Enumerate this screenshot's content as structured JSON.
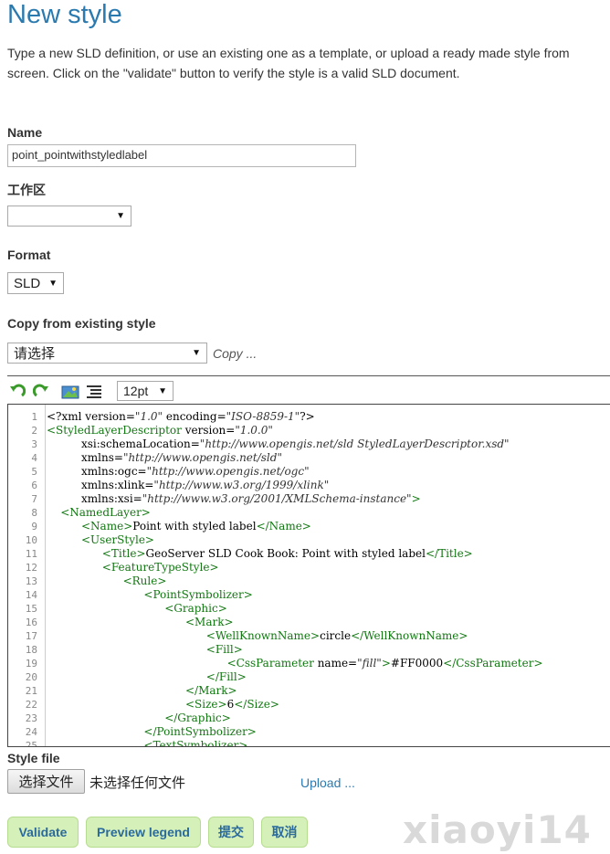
{
  "page": {
    "title": "New style",
    "intro": "Type a new SLD definition, or use an existing one as a template, or upload a ready made style from screen. Click on the \"validate\" button to verify the style is a valid SLD document."
  },
  "form": {
    "name_label": "Name",
    "name_value": "point_pointwithstyledlabel",
    "workspace_label": "工作区",
    "workspace_value": "",
    "format_label": "Format",
    "format_value": "SLD",
    "copy_label": "Copy from existing style",
    "copy_select_value": "请选择",
    "copy_link": "Copy ...",
    "style_file_label": "Style file",
    "file_button": "选择文件",
    "file_status": "未选择任何文件",
    "upload_link": "Upload ..."
  },
  "editor": {
    "font_size": "12pt",
    "icons": [
      "undo-icon",
      "redo-icon",
      "image-icon",
      "format-icon"
    ],
    "lines": [
      {
        "n": "1",
        "indent": 0,
        "parts": [
          [
            "p",
            "<?xml version="
          ],
          [
            "s",
            "\"1.0\""
          ],
          [
            "p",
            " encoding="
          ],
          [
            "s",
            "\"ISO-8859-1\""
          ],
          [
            "p",
            "?>"
          ]
        ]
      },
      {
        "n": "2",
        "indent": 0,
        "parts": [
          [
            "t",
            "<StyledLayerDescriptor"
          ],
          [
            "p",
            " version="
          ],
          [
            "s",
            "\"1.0.0\""
          ]
        ]
      },
      {
        "n": "3",
        "indent": 5,
        "parts": [
          [
            "p",
            "xsi:schemaLocation="
          ],
          [
            "s",
            "\"http://www.opengis.net/sld StyledLayerDescriptor.xsd\""
          ]
        ]
      },
      {
        "n": "4",
        "indent": 5,
        "parts": [
          [
            "p",
            "xmlns="
          ],
          [
            "s",
            "\"http://www.opengis.net/sld\""
          ]
        ]
      },
      {
        "n": "5",
        "indent": 5,
        "parts": [
          [
            "p",
            "xmlns:ogc="
          ],
          [
            "s",
            "\"http://www.opengis.net/ogc\""
          ]
        ]
      },
      {
        "n": "6",
        "indent": 5,
        "parts": [
          [
            "p",
            "xmlns:xlink="
          ],
          [
            "s",
            "\"http://www.w3.org/1999/xlink\""
          ]
        ]
      },
      {
        "n": "7",
        "indent": 5,
        "parts": [
          [
            "p",
            "xmlns:xsi="
          ],
          [
            "s",
            "\"http://www.w3.org/2001/XMLSchema-instance\""
          ],
          [
            "t",
            ">"
          ]
        ]
      },
      {
        "n": "8",
        "indent": 2,
        "parts": [
          [
            "t",
            "<NamedLayer>"
          ]
        ]
      },
      {
        "n": "9",
        "indent": 5,
        "parts": [
          [
            "t",
            "<Name>"
          ],
          [
            "p",
            "Point with styled label"
          ],
          [
            "t",
            "</Name>"
          ]
        ]
      },
      {
        "n": "10",
        "indent": 5,
        "parts": [
          [
            "t",
            "<UserStyle>"
          ]
        ]
      },
      {
        "n": "11",
        "indent": 8,
        "parts": [
          [
            "t",
            "<Title>"
          ],
          [
            "p",
            "GeoServer SLD Cook Book: Point with styled label"
          ],
          [
            "t",
            "</Title>"
          ]
        ]
      },
      {
        "n": "12",
        "indent": 8,
        "parts": [
          [
            "t",
            "<FeatureTypeStyle>"
          ]
        ]
      },
      {
        "n": "13",
        "indent": 11,
        "parts": [
          [
            "t",
            "<Rule>"
          ]
        ]
      },
      {
        "n": "14",
        "indent": 14,
        "parts": [
          [
            "t",
            "<PointSymbolizer>"
          ]
        ]
      },
      {
        "n": "15",
        "indent": 17,
        "parts": [
          [
            "t",
            "<Graphic>"
          ]
        ]
      },
      {
        "n": "16",
        "indent": 20,
        "parts": [
          [
            "t",
            "<Mark>"
          ]
        ]
      },
      {
        "n": "17",
        "indent": 23,
        "parts": [
          [
            "t",
            "<WellKnownName>"
          ],
          [
            "p",
            "circle"
          ],
          [
            "t",
            "</WellKnownName>"
          ]
        ]
      },
      {
        "n": "18",
        "indent": 23,
        "parts": [
          [
            "t",
            "<Fill>"
          ]
        ]
      },
      {
        "n": "19",
        "indent": 26,
        "parts": [
          [
            "t",
            "<CssParameter"
          ],
          [
            "p",
            " name="
          ],
          [
            "s",
            "\"fill\""
          ],
          [
            "t",
            ">"
          ],
          [
            "p",
            "#FF0000"
          ],
          [
            "t",
            "</CssParameter>"
          ]
        ]
      },
      {
        "n": "20",
        "indent": 23,
        "parts": [
          [
            "t",
            "</Fill>"
          ]
        ]
      },
      {
        "n": "21",
        "indent": 20,
        "parts": [
          [
            "t",
            "</Mark>"
          ]
        ]
      },
      {
        "n": "22",
        "indent": 20,
        "parts": [
          [
            "t",
            "<Size>"
          ],
          [
            "p",
            "6"
          ],
          [
            "t",
            "</Size>"
          ]
        ]
      },
      {
        "n": "23",
        "indent": 17,
        "parts": [
          [
            "t",
            "</Graphic>"
          ]
        ]
      },
      {
        "n": "24",
        "indent": 14,
        "parts": [
          [
            "t",
            "</PointSymbolizer>"
          ]
        ]
      },
      {
        "n": "25",
        "indent": 14,
        "parts": [
          [
            "t",
            "<TextSymbolizer>"
          ]
        ]
      }
    ]
  },
  "actions": {
    "validate": "Validate",
    "preview_legend": "Preview legend",
    "submit": "提交",
    "cancel": "取消"
  },
  "watermark": "xiaoyi14"
}
